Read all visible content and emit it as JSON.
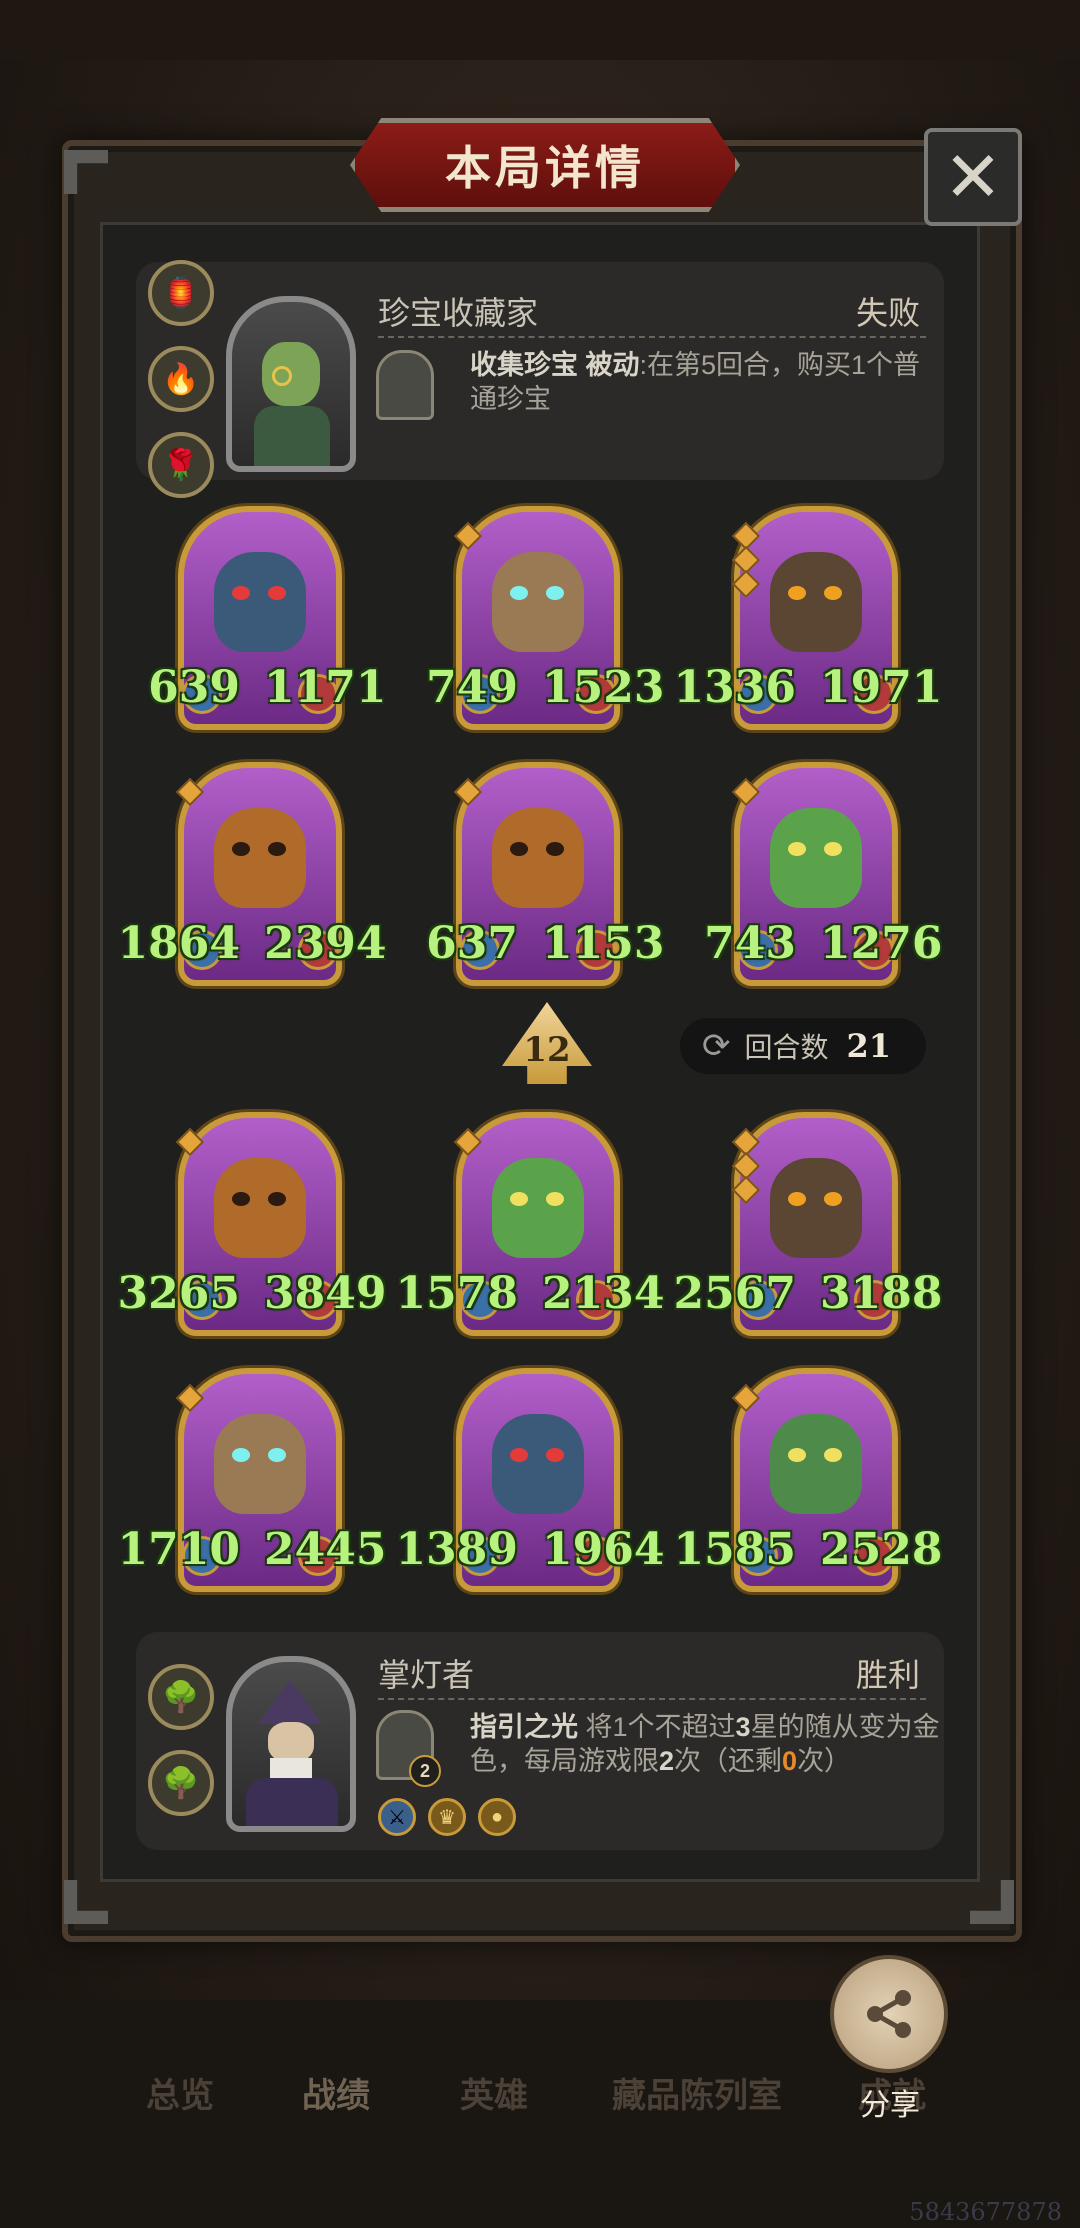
{
  "header": {
    "title": "本局详情",
    "close_icon": "close-icon"
  },
  "opponent": {
    "name": "珍宝收藏家",
    "result": "失败",
    "skill_name": "收集珍宝",
    "skill_tag": "被动",
    "skill_desc": ":在第5回合，购买1个普通珍宝",
    "relics": [
      "lantern-relic-icon",
      "fire-relic-icon",
      "rose-relic-icon"
    ]
  },
  "opponent_board": [
    {
      "atk": "639",
      "hp": "1171",
      "creature": "dragon",
      "stars": 0
    },
    {
      "atk": "749",
      "hp": "1523",
      "creature": "tree",
      "stars": 1
    },
    {
      "atk": "1336",
      "hp": "1971",
      "creature": "totem",
      "stars": 3
    },
    {
      "atk": "1864",
      "hp": "2394",
      "creature": "pumpkin",
      "stars": 1
    },
    {
      "atk": "637",
      "hp": "1153",
      "creature": "pumpkin",
      "stars": 1
    },
    {
      "atk": "743",
      "hp": "1276",
      "creature": "cactus",
      "stars": 1
    }
  ],
  "middle": {
    "level": "12",
    "round_label": "回合数",
    "round_value": "21"
  },
  "player_board": [
    {
      "atk": "3265",
      "hp": "3849",
      "creature": "pumpkin",
      "stars": 1
    },
    {
      "atk": "1578",
      "hp": "2134",
      "creature": "cactus",
      "stars": 1
    },
    {
      "atk": "2567",
      "hp": "3188",
      "creature": "totem",
      "stars": 3
    },
    {
      "atk": "1710",
      "hp": "2445",
      "creature": "tree",
      "stars": 1
    },
    {
      "atk": "1389",
      "hp": "1964",
      "creature": "dragon",
      "stars": 0
    },
    {
      "atk": "1585",
      "hp": "2528",
      "creature": "wyrm",
      "stars": 1
    }
  ],
  "player": {
    "name": "掌灯者",
    "result": "胜利",
    "skill_name": "指引之光",
    "skill_desc_1": "将1个不超过",
    "skill_stars": "3",
    "skill_desc_2": "星的随从变为金色，每局游戏限",
    "skill_limit": "2",
    "skill_desc_3": "次（还剩",
    "skill_remaining": "0",
    "skill_desc_4": "次）",
    "skill_charges": "2",
    "relics": [
      "bonsai-relic-icon",
      "bonsai-relic-icon"
    ],
    "buffs": [
      "sword-buff-icon",
      "crown-buff-icon",
      "coin-buff-icon"
    ]
  },
  "tabs": [
    "总览",
    "战绩",
    "英雄",
    "藏品陈列室",
    "成就"
  ],
  "share_label": "分享",
  "footer_id": "5843677878",
  "colors": {
    "stat_green": "#b8f27e",
    "gold": "#c89a3a",
    "banner_red": "#8c1c17",
    "remaining_orange": "#e8892a"
  }
}
